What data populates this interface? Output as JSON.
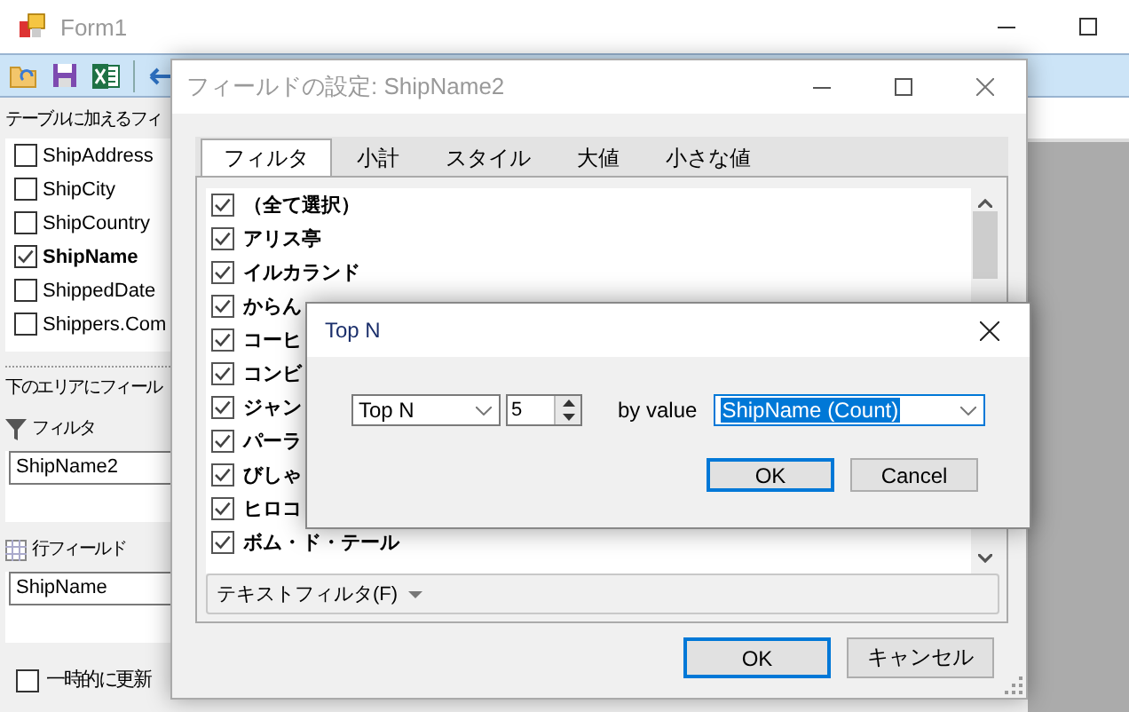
{
  "main_window": {
    "title": "Form1",
    "fields_label": "テーブルに加えるフィ",
    "fields": [
      {
        "label": "ShipAddress",
        "checked": false
      },
      {
        "label": "ShipCity",
        "checked": false
      },
      {
        "label": "ShipCountry",
        "checked": false
      },
      {
        "label": "ShipName",
        "checked": true
      },
      {
        "label": "ShippedDate",
        "checked": false
      },
      {
        "label": "Shippers.Com",
        "checked": false
      }
    ],
    "area_label": "下のエリアにフィール",
    "filter_label": "フィルタ",
    "filter_fields": [
      "ShipName2"
    ],
    "row_label": "行フィールド",
    "row_fields": [
      "ShipName"
    ],
    "defer_update": {
      "label": "一時的に更新",
      "checked": false
    }
  },
  "field_dialog": {
    "title": "フィールドの設定: ShipName2",
    "tabs": [
      {
        "label": "フィルタ",
        "selected": true
      },
      {
        "label": "小計",
        "selected": false
      },
      {
        "label": "スタイル",
        "selected": false
      },
      {
        "label": "大値",
        "selected": false
      },
      {
        "label": "小さな値",
        "selected": false
      }
    ],
    "items": [
      {
        "label": "（全て選択）",
        "checked": true
      },
      {
        "label": "アリス亭",
        "checked": true
      },
      {
        "label": "イルカランド",
        "checked": true
      },
      {
        "label": "からん",
        "checked": true
      },
      {
        "label": "コーヒ",
        "checked": true
      },
      {
        "label": "コンビ",
        "checked": true
      },
      {
        "label": "ジャン",
        "checked": true
      },
      {
        "label": "パーラ",
        "checked": true
      },
      {
        "label": "びしゃ",
        "checked": true
      },
      {
        "label": "ヒロコ",
        "checked": true
      },
      {
        "label": "ボム・ド・テール",
        "checked": true
      }
    ],
    "text_filter": "テキストフィルタ(F)",
    "buttons": [
      {
        "label": "OK",
        "default": true
      },
      {
        "label": "キャンセル",
        "default": false
      }
    ]
  },
  "topn_dialog": {
    "title": "Top N",
    "mode": "Top N",
    "count": "5",
    "by_label": "by value",
    "by_value": "ShipName (Count)",
    "buttons": [
      {
        "label": "OK",
        "default": true
      },
      {
        "label": "Cancel",
        "default": false
      }
    ]
  }
}
